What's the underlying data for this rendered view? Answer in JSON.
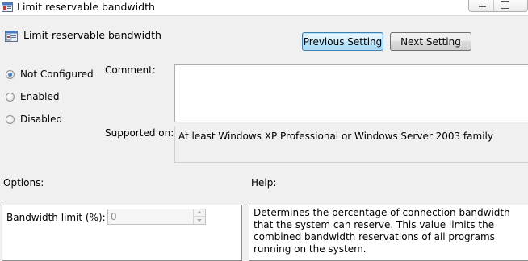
{
  "window": {
    "title": "Limit reservable bandwidth"
  },
  "header": {
    "policy_name": "Limit reservable bandwidth",
    "prev_label": "Previous Setting",
    "next_label": "Next Setting"
  },
  "state": {
    "options": [
      {
        "label": "Not Configured",
        "checked": true
      },
      {
        "label": "Enabled",
        "checked": false
      },
      {
        "label": "Disabled",
        "checked": false
      }
    ]
  },
  "comment": {
    "label": "Comment:",
    "value": ""
  },
  "supported": {
    "label": "Supported on:",
    "value": "At least Windows XP Professional or Windows Server 2003 family"
  },
  "options_panel": {
    "label": "Options:",
    "bandwidth_label": "Bandwidth limit (%):",
    "bandwidth_value": "0"
  },
  "help_panel": {
    "label": "Help:",
    "text": "Determines the percentage of connection bandwidth that the system can reserve. This value limits the combined bandwidth reservations of all programs running on the system."
  },
  "icons": {
    "title": "policy-settings-icon",
    "policy": "policy-settings-icon"
  }
}
